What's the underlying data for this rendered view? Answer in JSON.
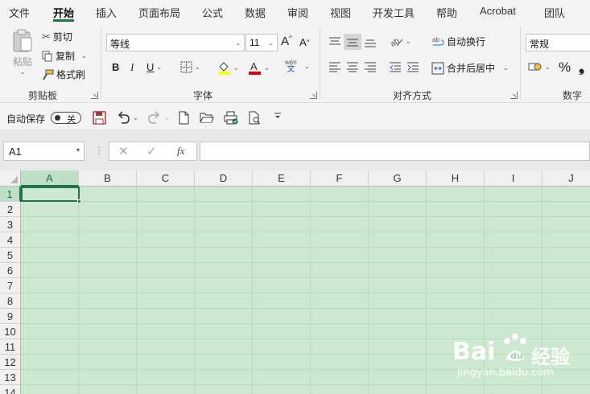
{
  "menu": {
    "items": [
      "文件",
      "开始",
      "插入",
      "页面布局",
      "公式",
      "数据",
      "审阅",
      "视图",
      "开发工具",
      "帮助",
      "Acrobat",
      "团队"
    ],
    "active": "开始"
  },
  "ribbon": {
    "clipboard": {
      "paste": "粘贴",
      "cut": "剪切",
      "copy": "复制",
      "format_painter": "格式刷",
      "group_label": "剪贴板"
    },
    "font": {
      "font_name": "等线",
      "font_size": "11",
      "bold": "B",
      "italic": "I",
      "underline": "U",
      "phonetic_top": "wén",
      "phonetic_bottom": "文",
      "group_label": "字体",
      "grow": "A",
      "shrink": "A"
    },
    "alignment": {
      "wrap_text": "自动换行",
      "merge_center": "合并后居中",
      "group_label": "对齐方式"
    },
    "number": {
      "format": "常规",
      "percent": "%",
      "group_label": "数字"
    }
  },
  "qat": {
    "autosave_label": "自动保存",
    "autosave_state": "关"
  },
  "formula_bar": {
    "name_box": "A1",
    "fx": "fx",
    "formula_value": ""
  },
  "sheet": {
    "columns": [
      "A",
      "B",
      "C",
      "D",
      "E",
      "F",
      "G",
      "H",
      "I",
      "J"
    ],
    "rows": [
      "1",
      "2",
      "3",
      "4",
      "5",
      "6",
      "7",
      "8",
      "9",
      "10",
      "11",
      "12",
      "13",
      "14"
    ],
    "selected_cell": "A1"
  },
  "watermark": {
    "brand": "Bai",
    "brand_tail": "经验",
    "url": "jingyan.baidu.com"
  },
  "colors": {
    "accent": "#217346",
    "grid_bg": "#cce8cf",
    "highlight_yellow": "#ffff00",
    "font_red": "#e00000",
    "save_purple": "#a4373a"
  }
}
